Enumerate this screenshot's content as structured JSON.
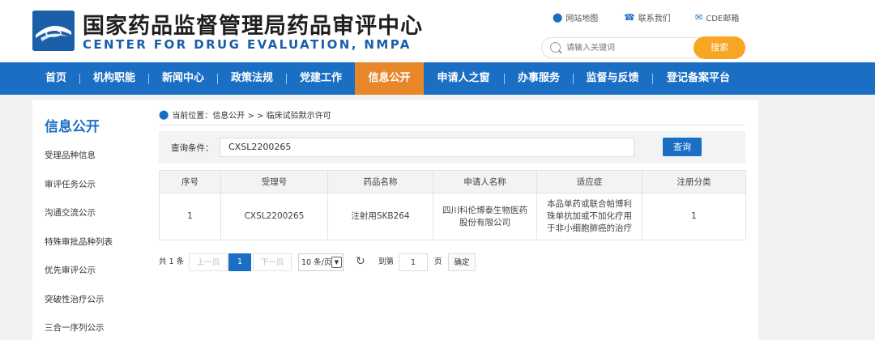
{
  "header": {
    "title_cn": "国家药品监督管理局药品审评中心",
    "title_en": "CENTER FOR DRUG EVALUATION, NMPA",
    "links": [
      {
        "label": "网站地图",
        "icon": "location-icon"
      },
      {
        "label": "联系我们",
        "icon": "phone-icon"
      },
      {
        "label": "CDE邮箱",
        "icon": "mail-icon"
      }
    ],
    "search_placeholder": "请输入关键词",
    "search_button": "搜索"
  },
  "nav": {
    "items": [
      "首页",
      "机构职能",
      "新闻中心",
      "政策法规",
      "党建工作",
      "信息公开",
      "申请人之窗",
      "办事服务",
      "监督与反馈",
      "登记备案平台"
    ],
    "active": "信息公开"
  },
  "sidebar": {
    "title": "信息公开",
    "items": [
      "受理品种信息",
      "审评任务公示",
      "沟通交流公示",
      "特殊审批品种列表",
      "优先审评公示",
      "突破性治疗公示",
      "三合一序列公示"
    ]
  },
  "breadcrumb": {
    "prefix": "当前位置：",
    "path": "信息公开 > > 临床试验默示许可"
  },
  "query": {
    "label": "查询条件：",
    "value": "CXSL2200265",
    "button": "查询"
  },
  "table": {
    "columns": [
      "序号",
      "受理号",
      "药品名称",
      "申请人名称",
      "适应症",
      "注册分类"
    ],
    "rows": [
      [
        "1",
        "CXSL2200265",
        "注射用SKB264",
        "四川科伦博泰生物医药股份有限公司",
        "本品单药或联合帕博利珠单抗加或不加化疗用于非小细胞肺癌的治疗",
        "1"
      ]
    ]
  },
  "pager": {
    "total": "共 1 条",
    "prev": "上一页",
    "current_page": "1",
    "next": "下一页",
    "page_size": "10 条/页",
    "goto_label": "到第",
    "goto_value": "1",
    "page_unit": "页",
    "confirm": "确定"
  },
  "colors": {
    "primary": "#1a6fc4",
    "nav_active": "#e8862a",
    "search_button": "#f6a623"
  }
}
